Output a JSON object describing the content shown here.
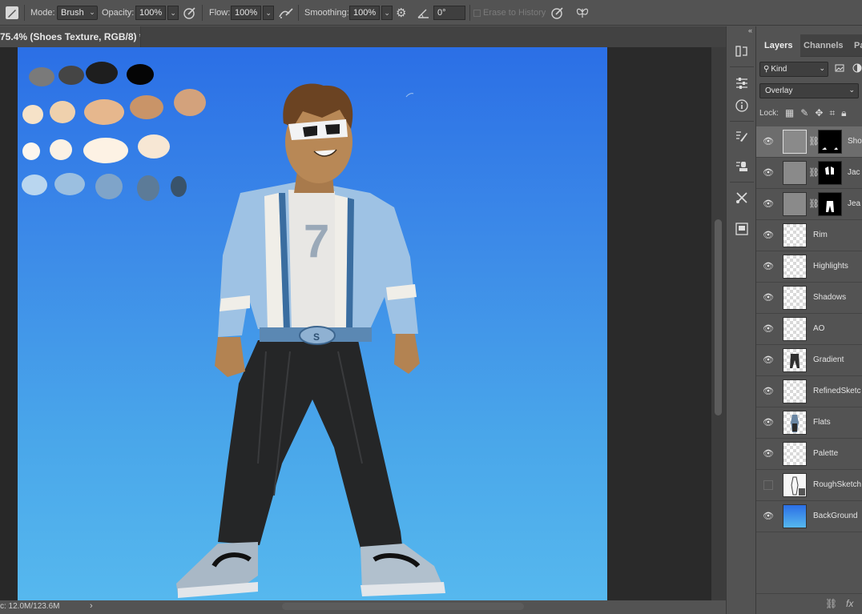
{
  "options_bar": {
    "mode_label": "Mode:",
    "mode_value": "Brush",
    "opacity_label": "Opacity:",
    "opacity_value": "100%",
    "flow_label": "Flow:",
    "flow_value": "100%",
    "smoothing_label": "Smoothing:",
    "smoothing_value": "100%",
    "angle_value": "0°",
    "erase_label": "Erase to History"
  },
  "document": {
    "tab_title": "75.4% (Shoes Texture, RGB/8) *"
  },
  "canvas": {
    "jacket_number": "7",
    "belt_letter": "S"
  },
  "status_bar": {
    "doc_info": "c: 12.0M/123.6M"
  },
  "layers_panel": {
    "tabs": [
      {
        "label": "Layers",
        "active": true
      },
      {
        "label": "Channels",
        "active": false
      },
      {
        "label": "Pa",
        "active": false
      }
    ],
    "kind_label": "Kind",
    "blend_mode": "Overlay",
    "lock_label": "Lock:",
    "layers": [
      {
        "name": "Sho",
        "thumb": "grey",
        "mask": true,
        "visible": true,
        "selected": true
      },
      {
        "name": "Jac",
        "thumb": "grey",
        "mask": true,
        "visible": true,
        "selected": false
      },
      {
        "name": "Jea",
        "thumb": "grey",
        "mask": true,
        "visible": true,
        "selected": false
      },
      {
        "name": "Rim",
        "thumb": "checker",
        "mask": false,
        "visible": true,
        "selected": false
      },
      {
        "name": "Highlights",
        "thumb": "checker",
        "mask": false,
        "visible": true,
        "selected": false
      },
      {
        "name": "Shadows",
        "thumb": "checker",
        "mask": false,
        "visible": true,
        "selected": false
      },
      {
        "name": "AO",
        "thumb": "checker",
        "mask": false,
        "visible": true,
        "selected": false
      },
      {
        "name": "Gradient",
        "thumb": "checker",
        "mask": false,
        "visible": true,
        "selected": false
      },
      {
        "name": "RefinedSketc",
        "thumb": "checker",
        "mask": false,
        "visible": true,
        "selected": false
      },
      {
        "name": "Flats",
        "thumb": "checker",
        "mask": false,
        "visible": true,
        "selected": false
      },
      {
        "name": "Palette",
        "thumb": "checker",
        "mask": false,
        "visible": true,
        "selected": false
      },
      {
        "name": "RoughSketch",
        "thumb": "checker",
        "mask": false,
        "visible": false,
        "selected": false
      },
      {
        "name": "BackGround",
        "thumb": "blue",
        "mask": false,
        "visible": true,
        "selected": false
      }
    ]
  },
  "colors": {
    "ui_bg": "#535353",
    "canvas_top": "#2b6fe6",
    "canvas_bottom": "#56b8ee"
  }
}
